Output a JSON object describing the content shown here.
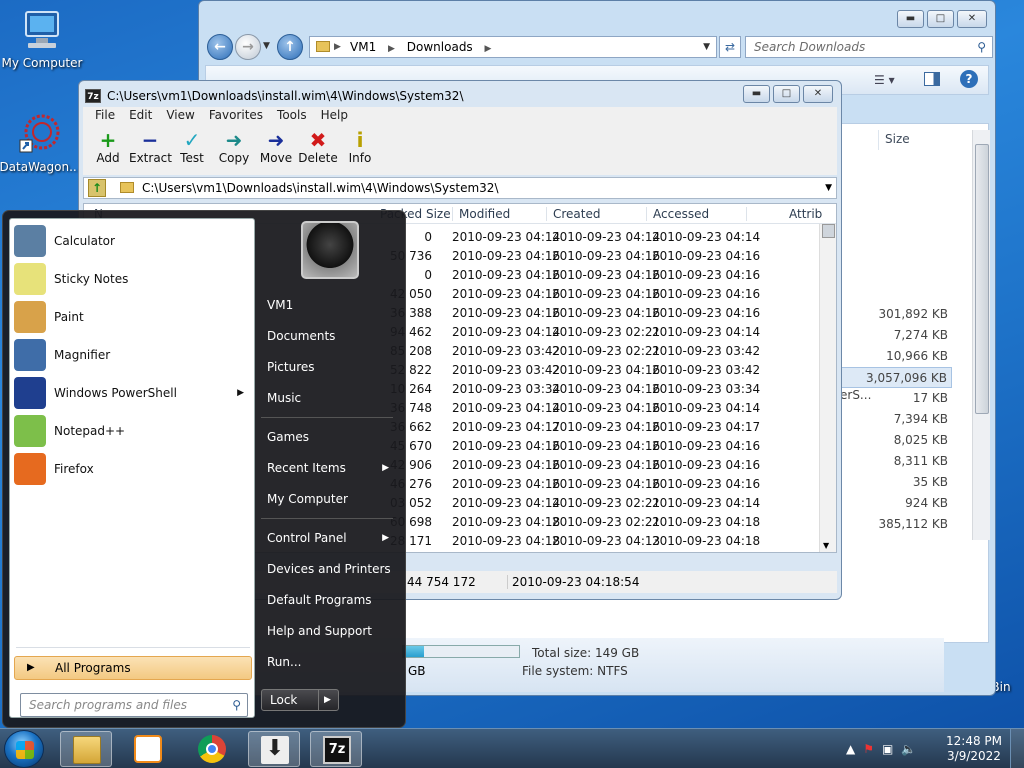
{
  "desktop": {
    "icons": [
      {
        "label": "My Computer"
      },
      {
        "label": "DataWagon..."
      },
      {
        "label": "Recycle Bin"
      }
    ]
  },
  "explorer": {
    "breadcrumb": [
      "VM1",
      "Downloads"
    ],
    "search_placeholder": "Search Downloads",
    "size_header": "Size",
    "sizes": [
      "301,892 KB",
      "7,274 KB",
      "10,966 KB",
      "3,057,096 KB",
      "17 KB",
      "7,394 KB",
      "8,025 KB",
      "8,311 KB",
      "35 KB",
      "924 KB",
      "385,112 KB"
    ],
    "selected_size_index": 3,
    "truncated_name": "erS...",
    "total_size_label": "Total size: 149 GB",
    "file_system_label": "File system: NTFS",
    "free_space_fragment": "GB",
    "disk_used_fraction": 0.18
  },
  "sevenzip": {
    "icon_text": "7z",
    "title": "C:\\Users\\vm1\\Downloads\\install.wim\\4\\Windows\\System32\\",
    "menu": [
      "File",
      "Edit",
      "View",
      "Favorites",
      "Tools",
      "Help"
    ],
    "toolbar": [
      {
        "label": "Add",
        "icon": "plus-icon",
        "glyph": "+",
        "color": "#1a9a1a"
      },
      {
        "label": "Extract",
        "icon": "minus-icon",
        "glyph": "−",
        "color": "#1a2f9a"
      },
      {
        "label": "Test",
        "icon": "check-icon",
        "glyph": "✓",
        "color": "#22a7c0"
      },
      {
        "label": "Copy",
        "icon": "copy-arrow-icon",
        "glyph": "➜",
        "color": "#1d8a8a"
      },
      {
        "label": "Move",
        "icon": "move-arrow-icon",
        "glyph": "➜",
        "color": "#1a2f9a"
      },
      {
        "label": "Delete",
        "icon": "delete-x-icon",
        "glyph": "✖",
        "color": "#d11a1a"
      },
      {
        "label": "Info",
        "icon": "info-icon",
        "glyph": "i",
        "color": "#b8a000"
      }
    ],
    "path": "C:\\Users\\vm1\\Downloads\\install.wim\\4\\Windows\\System32\\",
    "columns": {
      "name": "N",
      "packed": "Packed Size",
      "modified": "Modified",
      "created": "Created",
      "accessed": "Accessed",
      "attrib": "Attrib"
    },
    "rows": [
      {
        "packed": "0",
        "modified": "2010-09-23 04:14",
        "created": "2010-09-23 04:14",
        "accessed": "2010-09-23 04:14"
      },
      {
        "packed": "50 736",
        "modified": "2010-09-23 04:16",
        "created": "2010-09-23 04:16",
        "accessed": "2010-09-23 04:16"
      },
      {
        "packed": "0",
        "modified": "2010-09-23 04:16",
        "created": "2010-09-23 04:16",
        "accessed": "2010-09-23 04:16"
      },
      {
        "packed": "42 050",
        "modified": "2010-09-23 04:16",
        "created": "2010-09-23 04:16",
        "accessed": "2010-09-23 04:16"
      },
      {
        "packed": "36 388",
        "modified": "2010-09-23 04:16",
        "created": "2010-09-23 04:16",
        "accessed": "2010-09-23 04:16"
      },
      {
        "packed": "94 462",
        "modified": "2010-09-23 04:14",
        "created": "2010-09-23 02:21",
        "accessed": "2010-09-23 04:14"
      },
      {
        "packed": "85 208",
        "modified": "2010-09-23 03:42",
        "created": "2010-09-23 02:21",
        "accessed": "2010-09-23 03:42"
      },
      {
        "packed": "52 822",
        "modified": "2010-09-23 03:42",
        "created": "2010-09-23 04:16",
        "accessed": "2010-09-23 03:42"
      },
      {
        "packed": "10 264",
        "modified": "2010-09-23 03:34",
        "created": "2010-09-23 04:16",
        "accessed": "2010-09-23 03:34"
      },
      {
        "packed": "36 748",
        "modified": "2010-09-23 04:14",
        "created": "2010-09-23 04:16",
        "accessed": "2010-09-23 04:14"
      },
      {
        "packed": "36 662",
        "modified": "2010-09-23 04:17",
        "created": "2010-09-23 04:16",
        "accessed": "2010-09-23 04:17"
      },
      {
        "packed": "45 670",
        "modified": "2010-09-23 04:16",
        "created": "2010-09-23 04:16",
        "accessed": "2010-09-23 04:16"
      },
      {
        "packed": "42 906",
        "modified": "2010-09-23 04:16",
        "created": "2010-09-23 04:16",
        "accessed": "2010-09-23 04:16"
      },
      {
        "packed": "46 276",
        "modified": "2010-09-23 04:16",
        "created": "2010-09-23 04:16",
        "accessed": "2010-09-23 04:16"
      },
      {
        "packed": "03 052",
        "modified": "2010-09-23 04:14",
        "created": "2010-09-23 02:21",
        "accessed": "2010-09-23 04:14"
      },
      {
        "packed": "60 698",
        "modified": "2010-09-23 04:18",
        "created": "2010-09-23 02:21",
        "accessed": "2010-09-23 04:18"
      },
      {
        "packed": "28 171",
        "modified": "2010-09-23 04:18",
        "created": "2010-09-23 04:13",
        "accessed": "2010-09-23 04:18"
      }
    ],
    "status": {
      "packed_total": "44 754 172",
      "timestamp": "2010-09-23 04:18:54"
    }
  },
  "startmenu": {
    "programs": [
      {
        "label": "Calculator",
        "icon": "calculator-icon",
        "color": "#5b7fa3",
        "submenu": false
      },
      {
        "label": "Sticky Notes",
        "icon": "sticky-notes-icon",
        "color": "#e7e27a",
        "submenu": false
      },
      {
        "label": "Paint",
        "icon": "paint-icon",
        "color": "#d8a24a",
        "submenu": false
      },
      {
        "label": "Magnifier",
        "icon": "magnifier-icon",
        "color": "#3f6da8",
        "submenu": false
      },
      {
        "label": "Windows PowerShell",
        "icon": "powershell-icon",
        "color": "#1f3f8f",
        "submenu": true
      },
      {
        "label": "Notepad++",
        "icon": "notepadpp-icon",
        "color": "#7dbf4a",
        "submenu": false
      },
      {
        "label": "Firefox",
        "icon": "firefox-icon",
        "color": "#e66a1f",
        "submenu": false
      }
    ],
    "all_programs": "All Programs",
    "search_placeholder": "Search programs and files",
    "right_items": [
      {
        "label": "VM1",
        "submenu": false
      },
      {
        "label": "Documents",
        "submenu": false
      },
      {
        "label": "Pictures",
        "submenu": false
      },
      {
        "label": "Music",
        "submenu": false
      },
      {
        "label": "Games",
        "submenu": false
      },
      {
        "label": "Recent Items",
        "submenu": true
      },
      {
        "label": "My Computer",
        "submenu": false
      },
      {
        "label": "Control Panel",
        "submenu": true
      },
      {
        "label": "Devices and Printers",
        "submenu": false
      },
      {
        "label": "Default Programs",
        "submenu": false
      },
      {
        "label": "Help and Support",
        "submenu": false
      },
      {
        "label": "Run...",
        "submenu": false
      }
    ],
    "lock_label": "Lock"
  },
  "taskbar": {
    "apps": [
      {
        "name": "file-explorer-icon",
        "active": true
      },
      {
        "name": "media-player-icon",
        "active": false
      },
      {
        "name": "chrome-icon",
        "active": false
      },
      {
        "name": "download-icon",
        "active": true
      },
      {
        "name": "sevenzip-icon",
        "active": true
      }
    ],
    "time": "12:48 PM",
    "date": "3/9/2022"
  }
}
